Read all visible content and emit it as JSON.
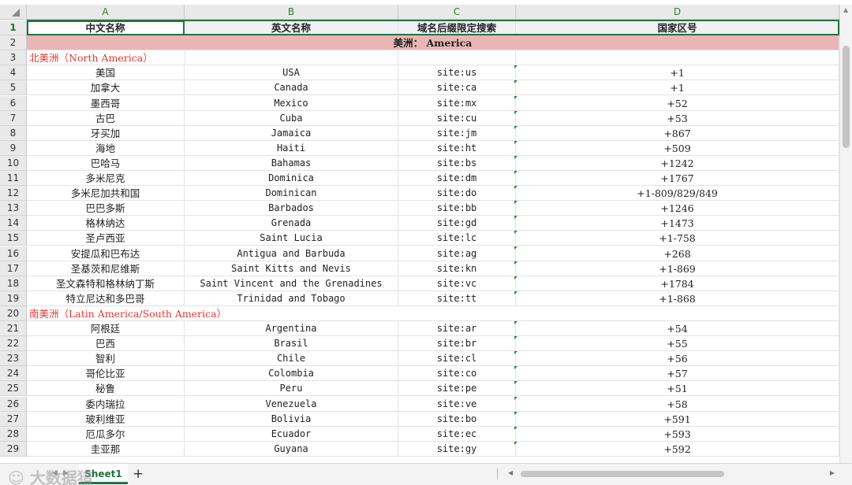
{
  "columns": [
    "A",
    "B",
    "C",
    "D"
  ],
  "header": {
    "row": "1",
    "a": "中文名称",
    "b": "英文名称",
    "c": "域名后缀限定搜索",
    "d": "国家区号"
  },
  "region_banner": {
    "row": "2",
    "text": "美洲：  America"
  },
  "sections": {
    "north": {
      "row": "3",
      "label": "北美洲（North America）"
    },
    "south": {
      "row": "20",
      "label": "南美洲（Latin America/South America）"
    }
  },
  "rows": [
    {
      "n": "4",
      "zh": "美国",
      "en": "USA",
      "site": "site:us",
      "code": "+1"
    },
    {
      "n": "5",
      "zh": "加拿大",
      "en": "Canada",
      "site": "site:ca",
      "code": "+1"
    },
    {
      "n": "6",
      "zh": "墨西哥",
      "en": "Mexico",
      "site": "site:mx",
      "code": "+52"
    },
    {
      "n": "7",
      "zh": "古巴",
      "en": "Cuba",
      "site": "site:cu",
      "code": "+53"
    },
    {
      "n": "8",
      "zh": "牙买加",
      "en": "Jamaica",
      "site": "site:jm",
      "code": "+867"
    },
    {
      "n": "9",
      "zh": "海地",
      "en": "Haiti",
      "site": "site:ht",
      "code": "+509"
    },
    {
      "n": "10",
      "zh": "巴哈马",
      "en": "Bahamas",
      "site": "site:bs",
      "code": "+1242"
    },
    {
      "n": "11",
      "zh": "多米尼克",
      "en": "Dominica",
      "site": "site:dm",
      "code": "+1767"
    },
    {
      "n": "12",
      "zh": "多米尼加共和国",
      "en": "Dominican",
      "site": "site:do",
      "code": "+1-809/829/849"
    },
    {
      "n": "13",
      "zh": "巴巴多斯",
      "en": "Barbados",
      "site": "site:bb",
      "code": "+1246"
    },
    {
      "n": "14",
      "zh": "格林纳达",
      "en": "Grenada",
      "site": "site:gd",
      "code": "+1473"
    },
    {
      "n": "15",
      "zh": "圣卢西亚",
      "en": "Saint Lucia",
      "site": "site:lc",
      "code": "+1-758"
    },
    {
      "n": "16",
      "zh": "安提瓜和巴布达",
      "en": "Antigua and Barbuda",
      "site": "site:ag",
      "code": "+268"
    },
    {
      "n": "17",
      "zh": "圣基茨和尼维斯",
      "en": "Saint Kitts and Nevis",
      "site": "site:kn",
      "code": "+1-869"
    },
    {
      "n": "18",
      "zh": "圣文森特和格林纳丁斯",
      "en": "Saint Vincent and the Grenadines",
      "site": "site:vc",
      "code": "+1784"
    },
    {
      "n": "19",
      "zh": "特立尼达和多巴哥",
      "en": "Trinidad and Tobago",
      "site": "site:tt",
      "code": "+1-868"
    },
    {
      "n": "21",
      "zh": "阿根廷",
      "en": "Argentina",
      "site": "site:ar",
      "code": "+54"
    },
    {
      "n": "22",
      "zh": "巴西",
      "en": "Brasil",
      "site": "site:br",
      "code": "+55"
    },
    {
      "n": "23",
      "zh": "智利",
      "en": "Chile",
      "site": "site:cl",
      "code": "+56"
    },
    {
      "n": "24",
      "zh": "哥伦比亚",
      "en": "Colombia",
      "site": "site:co",
      "code": "+57"
    },
    {
      "n": "25",
      "zh": "秘鲁",
      "en": "Peru",
      "site": "site:pe",
      "code": "+51"
    },
    {
      "n": "26",
      "zh": "委内瑞拉",
      "en": "Venezuela",
      "site": "site:ve",
      "code": "+58"
    },
    {
      "n": "27",
      "zh": "玻利维亚",
      "en": "Bolivia",
      "site": "site:bo",
      "code": "+591"
    },
    {
      "n": "28",
      "zh": "厄瓜多尔",
      "en": "Ecuador",
      "site": "site:ec",
      "code": "+593"
    },
    {
      "n": "29",
      "zh": "圭亚那",
      "en": "Guyana",
      "site": "site:gy",
      "code": "+592"
    }
  ],
  "sheet_tab": "Sheet1",
  "add_tab_label": "+",
  "watermark": "大数据猎",
  "colors": {
    "accent": "#217346",
    "section_red": "#e53935",
    "banner_pink": "#e9b5b5",
    "comment_tri": "#1e8e3e"
  }
}
